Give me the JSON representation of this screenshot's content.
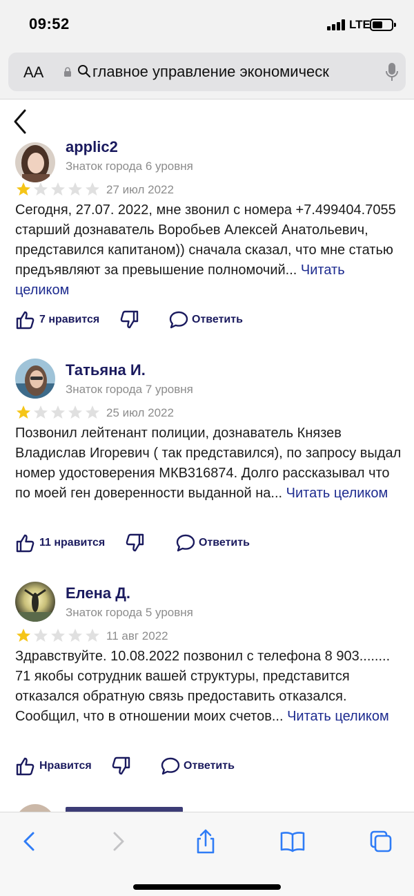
{
  "status_bar": {
    "time": "09:52",
    "network": "LTE",
    "signal_icon": "signal-bars-icon",
    "battery_icon": "battery-icon"
  },
  "address_bar": {
    "text_size_label": "AA",
    "url_text": "главное управление экономическ",
    "icons": [
      "lock-icon",
      "search-icon",
      "microphone-icon"
    ]
  },
  "page": {
    "back_icon": "chevron-left-icon"
  },
  "reviews": [
    {
      "author": "applic2",
      "level": "Знаток города 6 уровня",
      "rating": 1,
      "date": "27 июл 2022",
      "text": "Сегодня, 27.07. 2022, мне звонил с номера +7.499404.7055 старший дознаватель Воробьев Алексей Анатольевич, представился капитаном)) сначала сказал, что мне статью предъявляют за превышение полномочий...",
      "read_more": "Читать целиком",
      "likes_label": "7 нравится",
      "reply_label": "Ответить"
    },
    {
      "author": "Татьяна И.",
      "level": "Знаток города 7 уровня",
      "rating": 1,
      "date": "25 июл 2022",
      "text": "Позвонил лейтенант полиции, дознаватель Князев Владислав Игоревич ( так представился), по запросу выдал номер удостоверения МКВ316874. Долго рассказывал что по моей ген доверенности выданной на...",
      "read_more": "Читать целиком",
      "likes_label": "11 нравится",
      "reply_label": "Ответить"
    },
    {
      "author": "Елена Д.",
      "level": "Знаток города 5 уровня",
      "rating": 1,
      "date": "11 авг 2022",
      "text": "Здравствуйте. 10.08.2022 позвонил с телефона 8 903........ 71 якобы сотрудник вашей структуры, представится отказался обратную связь предоставить отказался. Сообщил, что в отношении моих счетов...",
      "read_more": "Читать целиком",
      "likes_label": "Нравится",
      "reply_label": "Ответить"
    }
  ],
  "colors": {
    "star_filled": "#f5c518",
    "star_empty": "#e0e0e0",
    "author": "#1a1a5e",
    "link": "#1d2b8f",
    "toolbar_icon": "#2f7cf6"
  },
  "toolbar": {
    "icons": [
      "back-icon",
      "forward-icon",
      "share-icon",
      "bookmarks-icon",
      "tabs-icon"
    ]
  }
}
